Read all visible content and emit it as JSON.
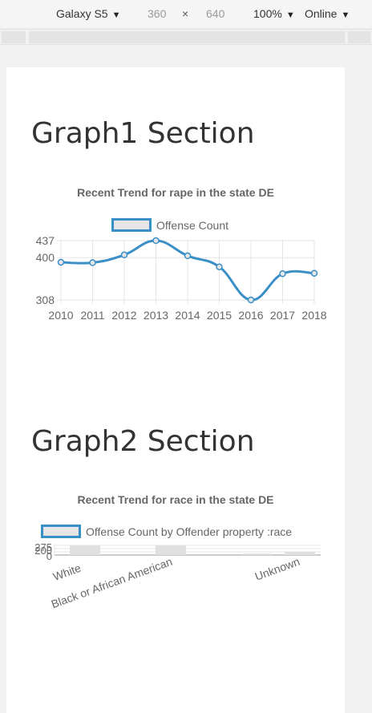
{
  "devtools": {
    "device": "Galaxy S5",
    "width": "360",
    "times": "×",
    "height": "640",
    "zoom": "100%",
    "network": "Online"
  },
  "graph1": {
    "heading": "Graph1 Section",
    "chart_data": {
      "type": "line",
      "title": "Recent Trend for rape in  the state DE",
      "legend": "Offense Count",
      "categories": [
        "2010",
        "2011",
        "2012",
        "2013",
        "2014",
        "2015",
        "2016",
        "2017",
        "2018"
      ],
      "series": [
        {
          "name": "Offense Count",
          "values": [
            390,
            389,
            406,
            437,
            404,
            380,
            308,
            365,
            366
          ]
        }
      ],
      "yticks": [
        437,
        400,
        308
      ],
      "ylim": [
        308,
        437
      ],
      "color": "#3a8fc6"
    }
  },
  "graph2": {
    "heading": "Graph2 Section",
    "chart_data": {
      "type": "bar",
      "title": "Recent Trend for race in  the state DE",
      "legend": "Offense Count by Offender property :race",
      "categories": [
        "White",
        "Black or African American",
        "Unknown"
      ],
      "bars": [
        275,
        275,
        40,
        100
      ],
      "yticks": [
        "275",
        "200",
        "0"
      ],
      "ylim": [
        0,
        275
      ],
      "color": "#3a8fc6"
    }
  }
}
